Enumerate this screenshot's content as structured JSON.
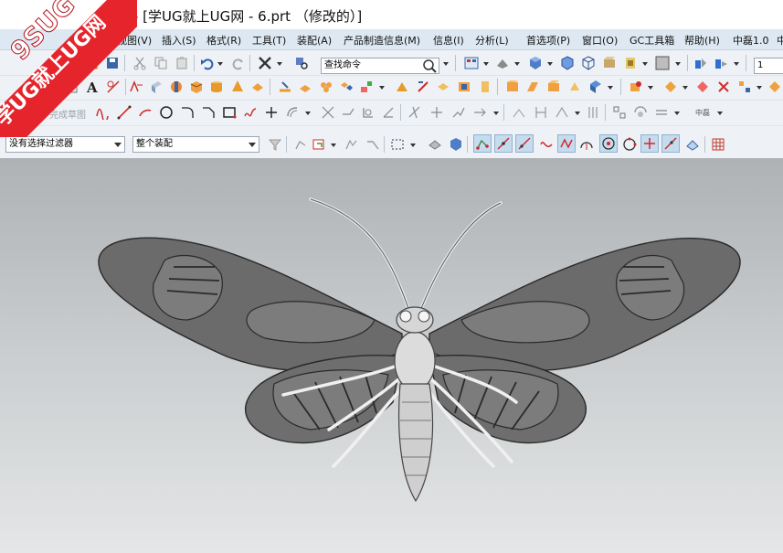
{
  "window": {
    "title": "- [学UG就上UG网 - 6.prt （修改的）]"
  },
  "watermark": {
    "brand": "9SUG",
    "slogan": "学UG就上UG网"
  },
  "menu": {
    "items": [
      "视图(V)",
      "插入(S)",
      "格式(R)",
      "工具(T)",
      "装配(A)",
      "产品制造信息(M)",
      "信息(I)",
      "分析(L)",
      "首选项(P)",
      "窗口(O)",
      "GC工具箱",
      "帮助(H)",
      "中磊1.0",
      "中"
    ]
  },
  "toolbar": {
    "search_placeholder": "查找命令",
    "layer_value": "1",
    "sketch_finish_label": "完成草图",
    "sketch_lang_label": "中磊",
    "selection_filter": "没有选择过滤器",
    "assembly_scope": "整个装配"
  },
  "icons": {
    "row1": [
      "open-folder-icon",
      "save-icon",
      "cut-icon",
      "copy-icon",
      "paste-icon",
      "undo-icon",
      "redo-icon",
      "delete-icon",
      "command-finder-icon",
      "view-orient-icon",
      "render-style-icon",
      "shaded-icon",
      "wireframe-icon",
      "hidden-icon",
      "material-icon",
      "background-color-icon",
      "layer-icon",
      "move-layer-icon"
    ],
    "row2": [
      "text-icon",
      "measure-icon",
      "feature-icon",
      "extrude-icon",
      "revolve-icon",
      "block-icon",
      "cylinder-icon",
      "cone-icon",
      "sphere-icon",
      "pattern-icon",
      "trim-icon",
      "unite-icon",
      "subtract-icon",
      "intersect-icon",
      "edge-blend-icon",
      "chamfer-icon",
      "shell-icon",
      "offset-icon",
      "thicken-icon",
      "sweep-icon",
      "mirror-icon",
      "scale-icon"
    ],
    "row3": [
      "profile-icon",
      "line-icon",
      "arc-icon",
      "circle-icon",
      "fillet-icon",
      "chamfer-sketch-icon",
      "rectangle-icon",
      "studio-spline-icon",
      "point-icon",
      "offset-curve-icon",
      "trim-curve-icon",
      "extend-curve-icon",
      "constraint-icon",
      "dimension-icon"
    ],
    "row4": [
      "filter-settings-icon",
      "snap-icon",
      "select-box-icon",
      "solid-body-icon",
      "component-icon",
      "endpoint-snap-icon",
      "midpoint-snap-icon",
      "control-point-icon",
      "intersection-icon",
      "center-icon",
      "quadrant-icon",
      "point-on-curve-icon",
      "grid-icon"
    ]
  },
  "colors": {
    "menubar": "#dde8f2",
    "toolbar": "#eef2f6",
    "viewport_top": "#aeb2b5",
    "viewport_bottom": "#e4e6e7",
    "wing_fill": "#6b6b6b",
    "watermark_red": "#e5242b"
  }
}
